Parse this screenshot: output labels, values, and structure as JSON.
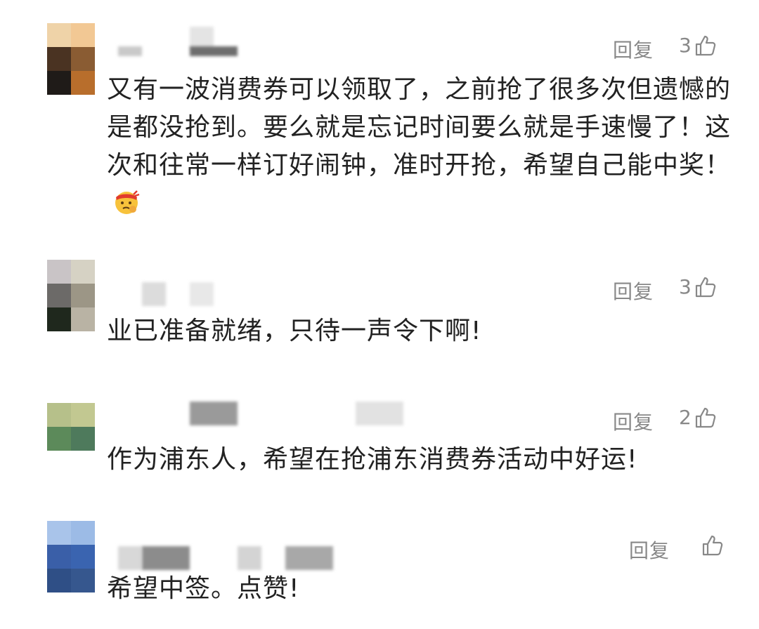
{
  "comments": [
    {
      "reply_label": "回复",
      "like_count": "3",
      "text": "又有一波消费券可以领取了，之前抢了很多次但遗憾的是都没抢到。要么就是忘记时间要么就是手速慢了！这次和往常一样订好闹钟，准时开抢，希望自己能中奖！",
      "emoji": "thinking-face-with-headband"
    },
    {
      "reply_label": "回复",
      "like_count": "3",
      "text": "业已准备就绪，只待一声令下啊!"
    },
    {
      "reply_label": "回复",
      "like_count": "2",
      "text": "作为浦东人，希望在抢浦东消费券活动中好运!"
    },
    {
      "reply_label": "回复",
      "like_count": "",
      "text": "希望中签。点赞!"
    }
  ],
  "icons": {
    "like": "thumbs-up-icon"
  },
  "colors": {
    "text": "#222222",
    "meta": "#888888"
  }
}
